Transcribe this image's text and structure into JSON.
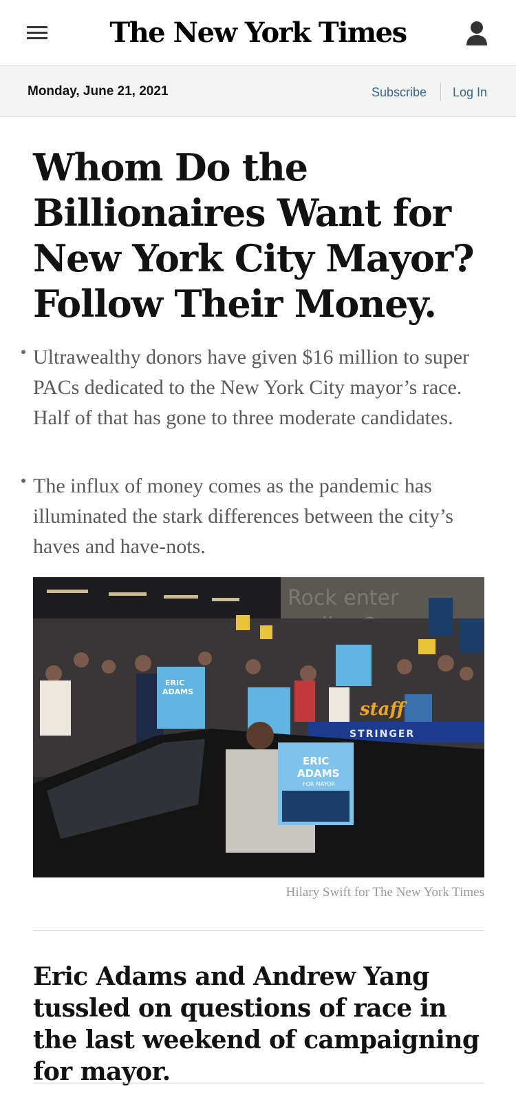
{
  "header": {
    "logo_text": "The New York Times",
    "menu_icon": "hamburger-menu-icon",
    "account_icon": "user-account-icon"
  },
  "datebar": {
    "date": "Monday, June 21, 2021",
    "subscribe_label": "Subscribe",
    "login_label": "Log In",
    "link_color": "#326891"
  },
  "lead_story": {
    "headline": "Whom Do the Billionaires Want for New York City Mayor? Follow Their Money.",
    "summary": [
      "Ultrawealthy donors have given $16 million to super PACs dedicated to the New York City mayor’s race. Half of that has gone to three moderate candidates.",
      "The influx of money comes as the pandemic has illuminated the stark differences between the city’s haves and have-nots."
    ],
    "photo": {
      "credit": "Hilary Swift for The New York Times",
      "sign_text": {
        "eric": "ERIC",
        "adams": "ADAMS",
        "for_mayor": "FOR MAYOR",
        "stringer": "STRINGER"
      }
    }
  },
  "second_story": {
    "headline": "Eric Adams and Andrew Yang tussled on questions of race in the last weekend of campaigning for mayor."
  }
}
